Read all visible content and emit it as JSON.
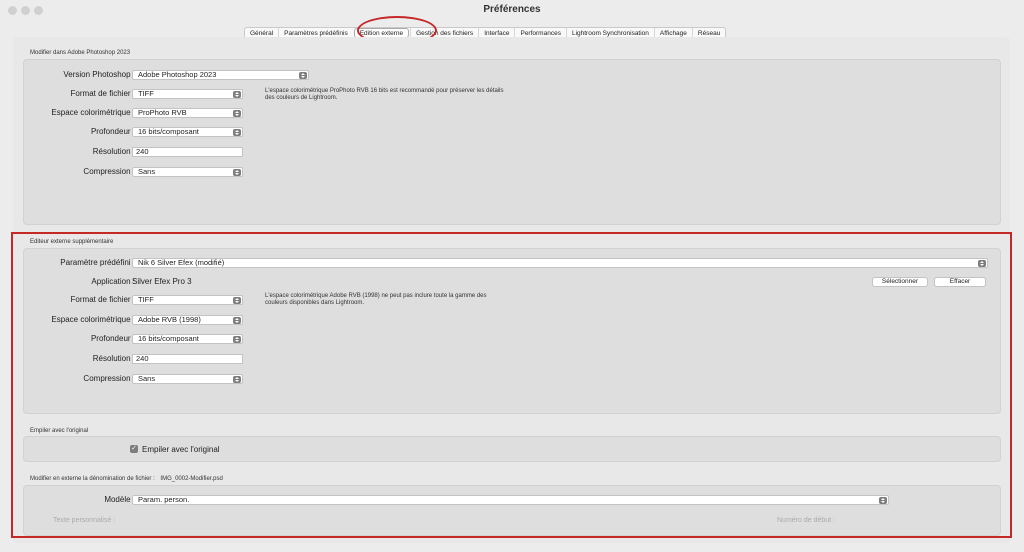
{
  "window": {
    "title": "Préférences"
  },
  "tabs": [
    {
      "label": "Général"
    },
    {
      "label": "Paramètres prédéfinis"
    },
    {
      "label": "Edition externe"
    },
    {
      "label": "Gestion des fichiers"
    },
    {
      "label": "Interface"
    },
    {
      "label": "Performances"
    },
    {
      "label": "Lightroom Synchronisation"
    },
    {
      "label": "Affichage"
    },
    {
      "label": "Réseau"
    }
  ],
  "photoshop": {
    "section_title": "Modifier dans Adobe Photoshop 2023",
    "version_label": "Version Photoshop :",
    "version_value": "Adobe Photoshop 2023",
    "format_label": "Format de fichier :",
    "format_value": "TIFF",
    "space_label": "Espace colorimétrique :",
    "space_value": "ProPhoto RVB",
    "depth_label": "Profondeur :",
    "depth_value": "16 bits/composant",
    "resolution_label": "Résolution :",
    "resolution_value": "240",
    "compression_label": "Compression :",
    "compression_value": "Sans",
    "note": "L'espace colorimétrique ProPhoto RVB 16 bits est recommandé pour préserver les détails des couleurs de Lightroom."
  },
  "external": {
    "section_title": "Editeur externe supplémentaire",
    "preset_label": "Paramètre prédéfini :",
    "preset_value": "Nik 6 Silver Efex (modifié)",
    "application_label": "Application :",
    "application_value": "Silver Efex Pro 3",
    "select_button": "Sélectionner",
    "clear_button": "Effacer",
    "format_label": "Format de fichier :",
    "format_value": "TIFF",
    "space_label": "Espace colorimétrique :",
    "space_value": "Adobe RVB (1998)",
    "depth_label": "Profondeur :",
    "depth_value": "16 bits/composant",
    "resolution_label": "Résolution :",
    "resolution_value": "240",
    "compression_label": "Compression :",
    "compression_value": "Sans",
    "note": "L'espace colorimétrique Adobe RVB (1998) ne peut pas inclure toute la gamme des couleurs disponibles dans Lightroom."
  },
  "stack": {
    "section_title": "Empiler avec l'original",
    "checkbox_label": "Empiler avec l'original",
    "checked": true
  },
  "naming": {
    "section_title": "Modifier en externe la dénomination de fichier :",
    "example": "IMG_0002-Modifier.psd",
    "template_label": "Modèle :",
    "template_value": "Param. person.",
    "custom_text_label": "Texte personnalisé :",
    "start_number_label": "Numéro de début :"
  },
  "colors": {
    "annotation": "#c62828"
  }
}
